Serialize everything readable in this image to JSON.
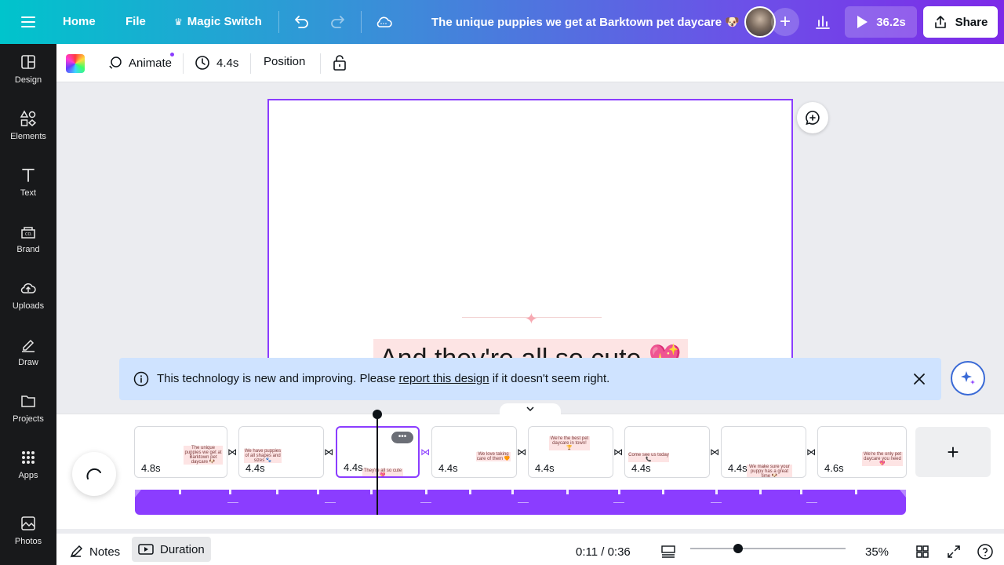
{
  "topbar": {
    "home": "Home",
    "file": "File",
    "magic_switch": "Magic Switch",
    "title": "The unique puppies we get at Barktown pet daycare 🐶",
    "play_duration": "36.2s",
    "share": "Share"
  },
  "toolbar": {
    "animate": "Animate",
    "duration": "4.4s",
    "position": "Position"
  },
  "sidebar": {
    "items": [
      {
        "label": "Design",
        "icon": "design-icon"
      },
      {
        "label": "Elements",
        "icon": "elements-icon"
      },
      {
        "label": "Text",
        "icon": "text-icon"
      },
      {
        "label": "Brand",
        "icon": "brand-icon"
      },
      {
        "label": "Uploads",
        "icon": "uploads-icon"
      },
      {
        "label": "Draw",
        "icon": "draw-icon"
      },
      {
        "label": "Projects",
        "icon": "projects-icon"
      },
      {
        "label": "Apps",
        "icon": "apps-icon"
      },
      {
        "label": "Photos",
        "icon": "photos-icon"
      }
    ]
  },
  "canvas": {
    "slide_text": "And they're all so cute 💖"
  },
  "banner": {
    "text_before": "This technology is new and improving. Please ",
    "link": "report this design",
    "text_after": " if it doesn't seem right."
  },
  "timeline": {
    "pages": [
      {
        "duration": "4.8s",
        "caption": "The unique puppies we get at Barktown pet daycare 🐶"
      },
      {
        "duration": "4.4s",
        "caption": "We have puppies of all shapes and sizes 🐾"
      },
      {
        "duration": "4.4s",
        "caption": "They're all so cute 💖",
        "selected": true
      },
      {
        "duration": "4.4s",
        "caption": "We love taking care of them 🧡"
      },
      {
        "duration": "4.4s",
        "caption": "We're the best pet daycare in town! 🏆"
      },
      {
        "duration": "4.4s",
        "caption": "Come see us today 📞"
      },
      {
        "duration": "4.4s",
        "caption": "We make sure your puppy has a great time 🐶"
      },
      {
        "duration": "4.6s",
        "caption": "We're the only pet daycare you need 💖"
      }
    ],
    "add_page": "+"
  },
  "bottombar": {
    "notes": "Notes",
    "duration": "Duration",
    "time": "0:11 / 0:36",
    "zoom": "35%",
    "zoom_level": 0.3
  },
  "colors": {
    "accent": "#8b3dff",
    "banner_bg": "#cfe3ff"
  }
}
